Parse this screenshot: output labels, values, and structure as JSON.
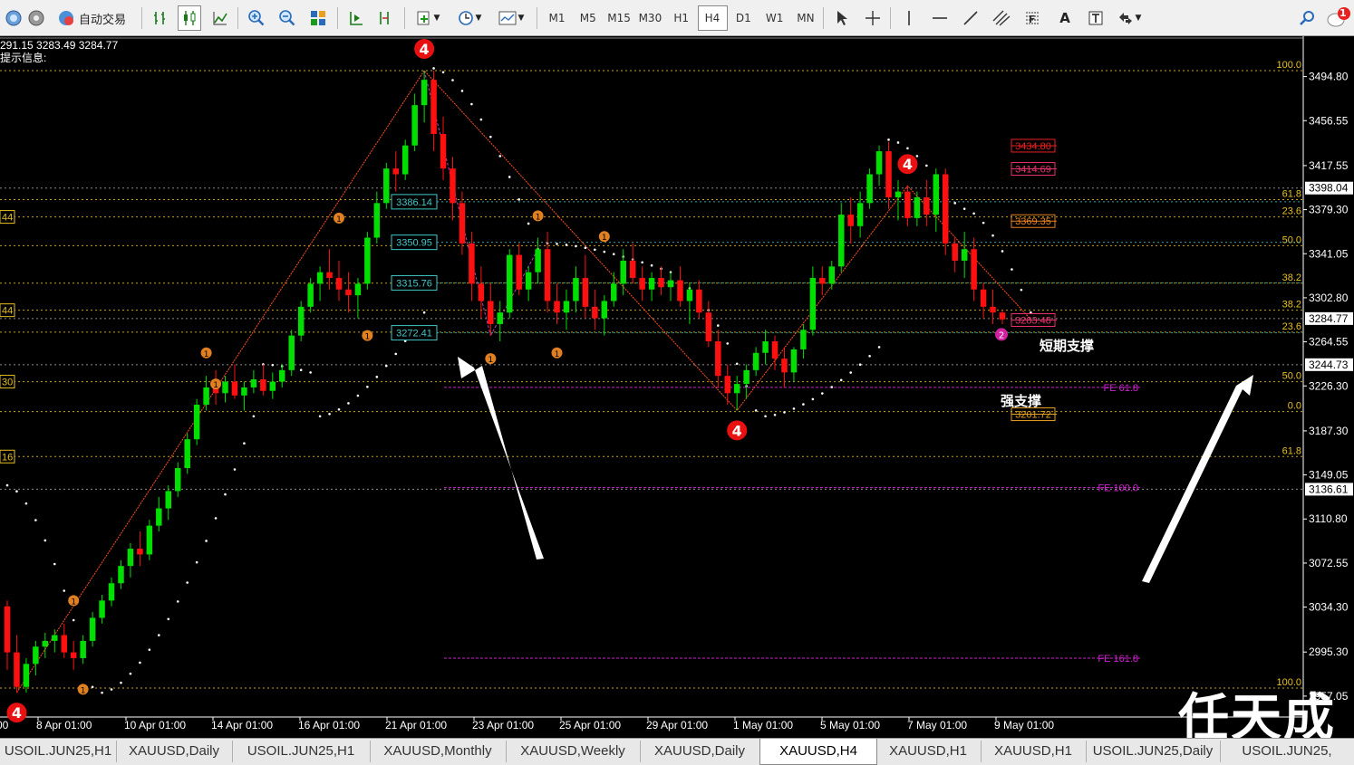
{
  "toolbar": {
    "auto_trade_label": "自动交易",
    "timeframes": [
      "M1",
      "M5",
      "M15",
      "M30",
      "H1",
      "H4",
      "D1",
      "W1",
      "MN"
    ],
    "active_timeframe": "H4",
    "text_tool": "A",
    "notification_count": "1"
  },
  "info": {
    "ohlc": "291.15 3283.49 3284.77",
    "prompt": "提示信息:"
  },
  "chart_data": {
    "type": "candlestick",
    "symbol": "XAUUSD",
    "timeframe": "H4",
    "ylim": [
      2960,
      3520
    ],
    "price_ticks": [
      "3494.80",
      "3456.55",
      "3417.55",
      "3379.30",
      "3341.05",
      "3302.80",
      "3264.55",
      "3226.30",
      "3187.30",
      "3149.05",
      "3110.80",
      "3072.55",
      "3034.30",
      "2995.30",
      "2957.05"
    ],
    "price_tick_values": [
      3494.8,
      3456.55,
      3417.55,
      3379.3,
      3341.05,
      3302.8,
      3264.55,
      3226.3,
      3187.3,
      3149.05,
      3110.8,
      3072.55,
      3034.3,
      2995.3,
      2957.05
    ],
    "price_boxes": [
      {
        "label": "3398.04",
        "value": 3398.04
      },
      {
        "label": "3284.77",
        "value": 3284.77
      },
      {
        "label": "3244.73",
        "value": 3244.73
      },
      {
        "label": "3136.61",
        "value": 3136.61
      }
    ],
    "time_labels": [
      "00",
      "8 Apr 01:00",
      "10 Apr 01:00",
      "14 Apr 01:00",
      "16 Apr 01:00",
      "21 Apr 01:00",
      "23 Apr 01:00",
      "25 Apr 01:00",
      "29 Apr 01:00",
      "1 May 01:00",
      "5 May 01:00",
      "7 May 01:00",
      "9 May 01:00"
    ],
    "level_boxes": [
      {
        "label": "3386.14",
        "value": 3386.14
      },
      {
        "label": "3350.95",
        "value": 3350.95
      },
      {
        "label": "3315.76",
        "value": 3315.76
      },
      {
        "label": "3272.41",
        "value": 3272.41
      }
    ],
    "right_levels": [
      {
        "label": "3434.80",
        "value": 3434.8
      },
      {
        "label": "3414.69",
        "value": 3414.69
      },
      {
        "label": "3369.35",
        "value": 3369.35
      },
      {
        "label": "3283.48",
        "value": 3283.48
      },
      {
        "label": "3201.72",
        "value": 3201.72
      }
    ],
    "fib_levels": [
      {
        "label": "100.0",
        "value": 3500.0
      },
      {
        "label": "61.8",
        "value": 3388.0
      },
      {
        "label": "23.6",
        "value": 3373.0
      },
      {
        "label": "50.0",
        "value": 3348.0
      },
      {
        "label": "38.2",
        "value": 3315.5
      },
      {
        "label": "38.2",
        "value": 3292.0
      },
      {
        "label": "23.6",
        "value": 3273.0
      },
      {
        "label": "50.0",
        "value": 3230.0
      },
      {
        "label": "0.0",
        "value": 3204.0
      },
      {
        "label": "61.8",
        "value": 3165.0
      },
      {
        "label": "100.0",
        "value": 2964.0
      }
    ],
    "fe_levels": [
      {
        "label": "FE 61.8",
        "value": 3225.0
      },
      {
        "label": "FE 100.0",
        "value": 3138.0
      },
      {
        "label": "FE 161.8",
        "value": 2990.0
      }
    ],
    "left_labels": [
      "44",
      "44",
      "30",
      "16"
    ],
    "left_label_values": [
      3373.0,
      3292.0,
      3230.0,
      3165.0
    ],
    "annotations": [
      "短期支撑",
      "强支撑"
    ],
    "wave_marker": "4",
    "wave_marker_small": "1",
    "wave_marker_pink": "2",
    "candles": [
      [
        3035,
        3040,
        2980,
        2995
      ],
      [
        2995,
        3010,
        2960,
        2965
      ],
      [
        2965,
        2990,
        2960,
        2985
      ],
      [
        2985,
        3005,
        2975,
        3000
      ],
      [
        3000,
        3012,
        2990,
        3005
      ],
      [
        3005,
        3015,
        2995,
        3010
      ],
      [
        3010,
        3020,
        2990,
        2995
      ],
      [
        2995,
        3005,
        2980,
        2990
      ],
      [
        2990,
        3010,
        2985,
        3005
      ],
      [
        3005,
        3030,
        3000,
        3025
      ],
      [
        3025,
        3045,
        3020,
        3040
      ],
      [
        3040,
        3060,
        3035,
        3055
      ],
      [
        3055,
        3075,
        3050,
        3070
      ],
      [
        3070,
        3090,
        3060,
        3085
      ],
      [
        3085,
        3100,
        3070,
        3080
      ],
      [
        3080,
        3110,
        3075,
        3105
      ],
      [
        3105,
        3130,
        3100,
        3120
      ],
      [
        3120,
        3140,
        3110,
        3135
      ],
      [
        3135,
        3160,
        3130,
        3155
      ],
      [
        3155,
        3185,
        3150,
        3180
      ],
      [
        3180,
        3215,
        3175,
        3210
      ],
      [
        3210,
        3235,
        3205,
        3225
      ],
      [
        3225,
        3240,
        3210,
        3220
      ],
      [
        3220,
        3235,
        3212,
        3230
      ],
      [
        3230,
        3245,
        3215,
        3218
      ],
      [
        3218,
        3230,
        3205,
        3225
      ],
      [
        3225,
        3240,
        3220,
        3232
      ],
      [
        3232,
        3245,
        3218,
        3222
      ],
      [
        3222,
        3238,
        3215,
        3230
      ],
      [
        3230,
        3245,
        3225,
        3240
      ],
      [
        3240,
        3275,
        3235,
        3270
      ],
      [
        3270,
        3300,
        3265,
        3295
      ],
      [
        3295,
        3320,
        3290,
        3315
      ],
      [
        3315,
        3330,
        3300,
        3325
      ],
      [
        3325,
        3345,
        3310,
        3320
      ],
      [
        3320,
        3335,
        3300,
        3310
      ],
      [
        3310,
        3325,
        3290,
        3305
      ],
      [
        3305,
        3320,
        3285,
        3315
      ],
      [
        3315,
        3360,
        3310,
        3355
      ],
      [
        3355,
        3395,
        3350,
        3385
      ],
      [
        3385,
        3420,
        3380,
        3415
      ],
      [
        3415,
        3430,
        3395,
        3410
      ],
      [
        3410,
        3440,
        3405,
        3435
      ],
      [
        3435,
        3480,
        3430,
        3470
      ],
      [
        3470,
        3500,
        3455,
        3492
      ],
      [
        3492,
        3500,
        3430,
        3445
      ],
      [
        3445,
        3460,
        3405,
        3415
      ],
      [
        3415,
        3425,
        3370,
        3385
      ],
      [
        3385,
        3395,
        3340,
        3350
      ],
      [
        3350,
        3360,
        3300,
        3315
      ],
      [
        3315,
        3330,
        3285,
        3300
      ],
      [
        3300,
        3315,
        3270,
        3280
      ],
      [
        3280,
        3300,
        3265,
        3290
      ],
      [
        3290,
        3345,
        3285,
        3340
      ],
      [
        3340,
        3350,
        3305,
        3310
      ],
      [
        3310,
        3330,
        3300,
        3325
      ],
      [
        3325,
        3355,
        3315,
        3345
      ],
      [
        3345,
        3360,
        3290,
        3300
      ],
      [
        3300,
        3315,
        3280,
        3290
      ],
      [
        3290,
        3310,
        3275,
        3300
      ],
      [
        3300,
        3330,
        3290,
        3320
      ],
      [
        3320,
        3340,
        3285,
        3295
      ],
      [
        3295,
        3310,
        3275,
        3285
      ],
      [
        3285,
        3305,
        3270,
        3300
      ],
      [
        3300,
        3325,
        3295,
        3315
      ],
      [
        3315,
        3345,
        3305,
        3335
      ],
      [
        3335,
        3350,
        3315,
        3320
      ],
      [
        3320,
        3330,
        3300,
        3310
      ],
      [
        3310,
        3325,
        3300,
        3320
      ],
      [
        3320,
        3330,
        3305,
        3312
      ],
      [
        3312,
        3325,
        3300,
        3318
      ],
      [
        3318,
        3330,
        3295,
        3300
      ],
      [
        3300,
        3315,
        3280,
        3310
      ],
      [
        3310,
        3318,
        3285,
        3290
      ],
      [
        3290,
        3300,
        3260,
        3265
      ],
      [
        3265,
        3275,
        3225,
        3235
      ],
      [
        3235,
        3245,
        3210,
        3220
      ],
      [
        3220,
        3235,
        3205,
        3228
      ],
      [
        3228,
        3245,
        3215,
        3240
      ],
      [
        3240,
        3260,
        3235,
        3255
      ],
      [
        3255,
        3275,
        3245,
        3265
      ],
      [
        3265,
        3270,
        3240,
        3250
      ],
      [
        3250,
        3260,
        3225,
        3238
      ],
      [
        3238,
        3260,
        3230,
        3258
      ],
      [
        3258,
        3280,
        3250,
        3275
      ],
      [
        3275,
        3330,
        3270,
        3320
      ],
      [
        3320,
        3330,
        3305,
        3315
      ],
      [
        3315,
        3335,
        3310,
        3330
      ],
      [
        3330,
        3385,
        3325,
        3375
      ],
      [
        3375,
        3390,
        3350,
        3365
      ],
      [
        3365,
        3395,
        3355,
        3385
      ],
      [
        3385,
        3415,
        3380,
        3410
      ],
      [
        3410,
        3435,
        3400,
        3430
      ],
      [
        3430,
        3438,
        3380,
        3390
      ],
      [
        3390,
        3405,
        3370,
        3395
      ],
      [
        3395,
        3400,
        3365,
        3372
      ],
      [
        3372,
        3395,
        3365,
        3390
      ],
      [
        3390,
        3405,
        3365,
        3375
      ],
      [
        3375,
        3415,
        3360,
        3410
      ],
      [
        3410,
        3415,
        3340,
        3350
      ],
      [
        3350,
        3355,
        3325,
        3335
      ],
      [
        3335,
        3360,
        3320,
        3345
      ],
      [
        3345,
        3355,
        3300,
        3310
      ],
      [
        3310,
        3315,
        3285,
        3295
      ],
      [
        3295,
        3310,
        3280,
        3290
      ],
      [
        3290,
        3292,
        3280,
        3284
      ]
    ]
  },
  "tabs": [
    {
      "label": "USOIL.JUN25,H1",
      "active": false
    },
    {
      "label": "XAUUSD,Daily",
      "active": false
    },
    {
      "label": "USOIL.JUN25,H1",
      "active": false
    },
    {
      "label": "XAUUSD,Monthly",
      "active": false
    },
    {
      "label": "XAUUSD,Weekly",
      "active": false
    },
    {
      "label": "XAUUSD,Daily",
      "active": false
    },
    {
      "label": "XAUUSD,H4",
      "active": true
    },
    {
      "label": "XAUUSD,H1",
      "active": false
    },
    {
      "label": "XAUUSD,H1",
      "active": false
    },
    {
      "label": "USOIL.JUN25,Daily",
      "active": false
    },
    {
      "label": "USOIL.JUN25,",
      "active": false
    }
  ],
  "watermark": "任天成",
  "colors": {
    "bull": "#00e000",
    "bear": "#ff1010",
    "fib": "#e8c020",
    "level": "#40c8c8",
    "fe": "#d020d0",
    "zigzag": "#ff5020"
  }
}
